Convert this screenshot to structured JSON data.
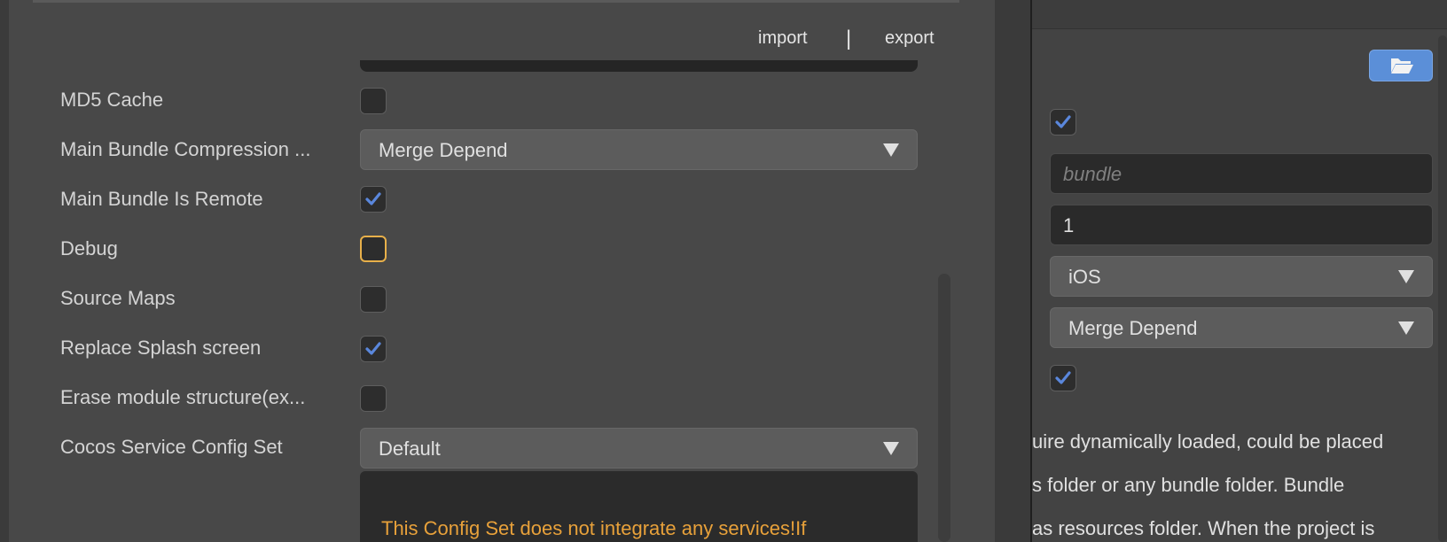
{
  "toolbar": {
    "import_label": "import",
    "separator": "|",
    "export_label": "export"
  },
  "settings": [
    {
      "label": "MD5 Cache",
      "type": "checkbox",
      "checked": false
    },
    {
      "label": "Main Bundle Compression ...",
      "type": "select",
      "value": "Merge Depend"
    },
    {
      "label": "Main Bundle Is Remote",
      "type": "checkbox",
      "checked": true
    },
    {
      "label": "Debug",
      "type": "checkbox",
      "checked": false,
      "focused": true
    },
    {
      "label": "Source Maps",
      "type": "checkbox",
      "checked": false
    },
    {
      "label": "Replace Splash screen",
      "type": "checkbox",
      "checked": true
    },
    {
      "label": "Erase module structure(ex...",
      "type": "checkbox",
      "checked": false
    },
    {
      "label": "Cocos Service Config Set",
      "type": "select",
      "value": "Default"
    }
  ],
  "warning_text": "This Config Set does not integrate any services!If",
  "right_panel": {
    "folder_icon": "folder-open-icon",
    "check1": true,
    "bundle_placeholder": "bundle",
    "version_value": "1",
    "platform_value": "iOS",
    "compression_value": "Merge Depend",
    "check2": true,
    "desc_lines": [
      "uire dynamically loaded, could be placed",
      "s folder or any bundle folder. Bundle",
      "as resources folder. When the project is"
    ]
  },
  "colors": {
    "accent_check": "#5a87dc",
    "focus_border": "#e8b04a",
    "warning": "#e8a13a",
    "folder_button": "#5b8fd8"
  }
}
